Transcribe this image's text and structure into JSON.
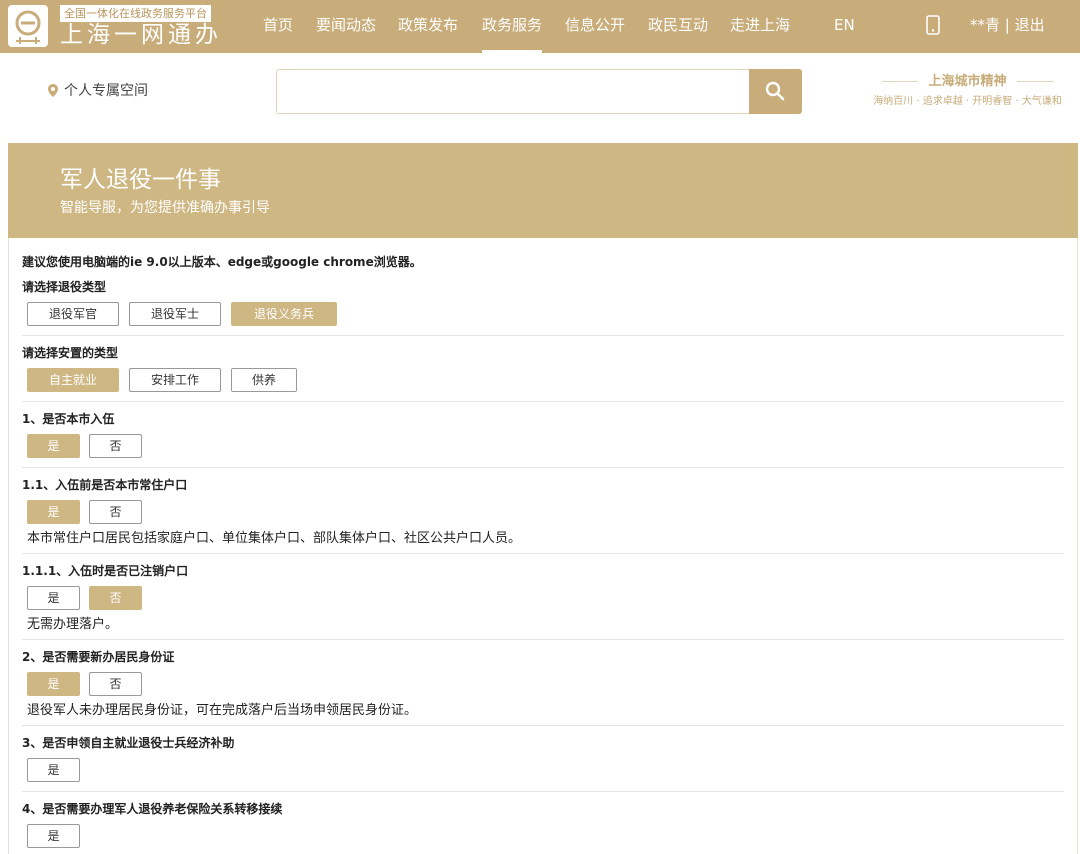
{
  "header": {
    "logo_sub": "全国一体化在线政务服务平台",
    "logo_title": "上海一网通办",
    "nav": [
      "首页",
      "要闻动态",
      "政策发布",
      "政务服务",
      "信息公开",
      "政民互动",
      "走进上海",
      "EN"
    ],
    "active_nav": "政务服务",
    "user": "**青 | 退出"
  },
  "search": {
    "personal_space": "个人专属空间",
    "placeholder": ""
  },
  "spirit": {
    "title": "上海城市精神",
    "subtitle": "海纳百川 · 追求卓越 · 开明睿智 · 大气谦和"
  },
  "banner": {
    "title": "军人退役一件事",
    "subtitle": "智能导服，为您提供准确办事引导"
  },
  "content": {
    "notice": "建议您使用电脑端的ie 9.0以上版本、edge或google chrome浏览器。",
    "questions": [
      {
        "label": "请选择退役类型",
        "options": [
          "退役军官",
          "退役军士",
          "退役义务兵"
        ],
        "selected": "退役义务兵"
      },
      {
        "label": "请选择安置的类型",
        "options": [
          "自主就业",
          "安排工作",
          "供养"
        ],
        "selected": "自主就业"
      },
      {
        "label": "1、是否本市入伍",
        "options": [
          "是",
          "否"
        ],
        "selected": "是"
      },
      {
        "label": "1.1、入伍前是否本市常住户口",
        "options": [
          "是",
          "否"
        ],
        "selected": "是",
        "note": "本市常住户口居民包括家庭户口、单位集体户口、部队集体户口、社区公共户口人员。"
      },
      {
        "label": "1.1.1、入伍时是否已注销户口",
        "options": [
          "是",
          "否"
        ],
        "selected": "否",
        "note": "无需办理落户。"
      },
      {
        "label": "2、是否需要新办居民身份证",
        "options": [
          "是",
          "否"
        ],
        "selected": "是",
        "note": "退役军人未办理居民身份证，可在完成落户后当场申领居民身份证。"
      },
      {
        "label": "3、是否申领自主就业退役士兵经济补助",
        "options": [
          "是"
        ],
        "selected": ""
      },
      {
        "label": "4、是否需要办理军人退役养老保险关系转移接续",
        "options": [
          "是"
        ],
        "selected": ""
      }
    ]
  },
  "colors": {
    "brand": "#c8ac7a",
    "banner": "#cfb784",
    "selected_option": "#cfb784"
  },
  "icons": {
    "logo": "logo-icon",
    "phone": "mobile-phone-icon",
    "location": "location-pin-icon",
    "search": "search-icon"
  }
}
